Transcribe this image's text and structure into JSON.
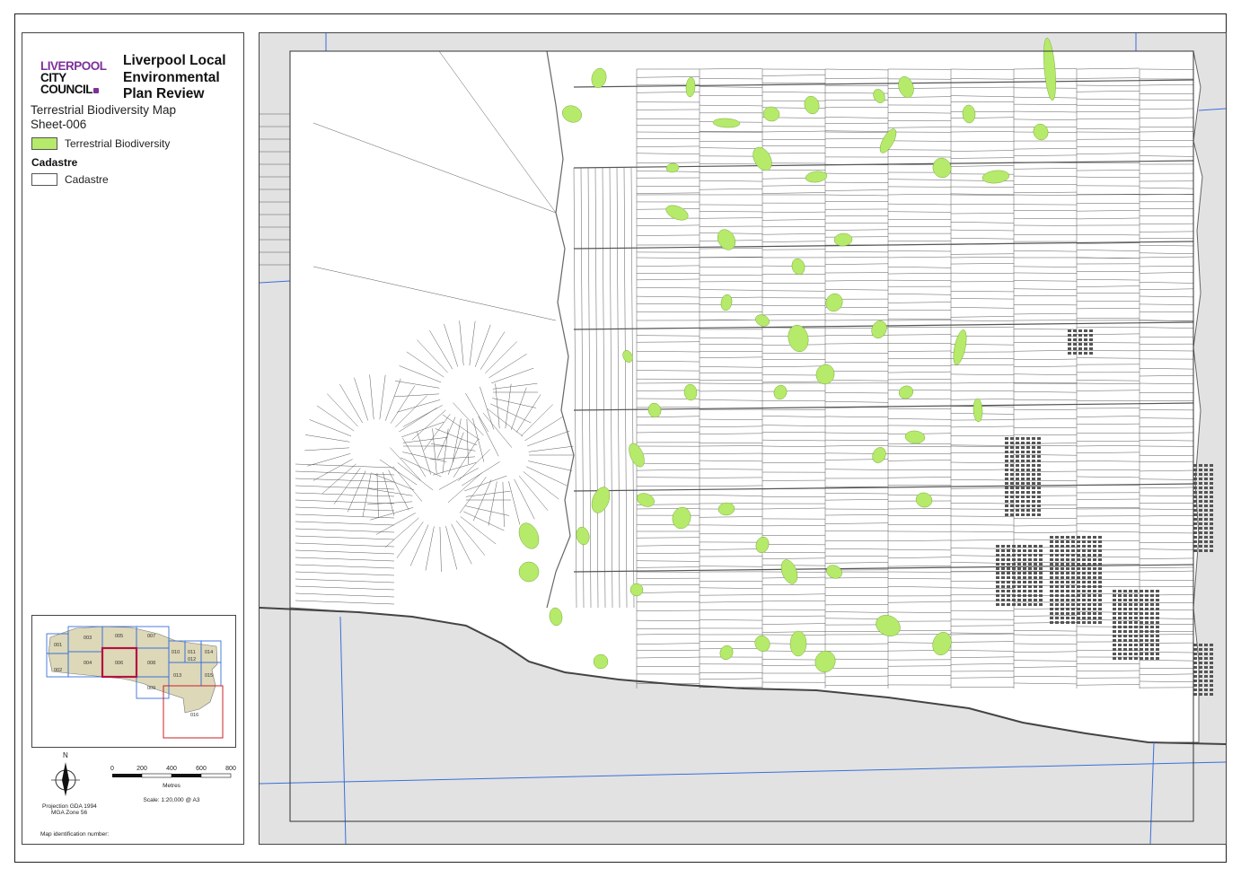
{
  "legend": {
    "logo": {
      "line1": "LIVERPOOL",
      "line2": "CITY",
      "line3": "COUNCIL"
    },
    "plan_title": "Liverpool Local Environmental Plan Review",
    "map_title": "Terrestrial Biodiversity Map",
    "sheet": "Sheet-006",
    "items": [
      {
        "label": "Terrestrial Biodiversity",
        "color": "#b6ea6a"
      }
    ],
    "cadastre_heading": "Cadastre",
    "cadastre_item": "Cadastre",
    "inset_sheets": [
      "001",
      "002",
      "003",
      "004",
      "005",
      "006",
      "007",
      "008",
      "009",
      "010",
      "011",
      "012",
      "013",
      "014",
      "015",
      "016"
    ],
    "current_sheet": "006",
    "north_label": "N",
    "scale_ticks": [
      "0",
      "200",
      "400",
      "600",
      "800"
    ],
    "scale_unit": "Metres",
    "scale_text": "Scale: 1:20,000 @ A3",
    "projection_line1": "Projection GDA 1994",
    "projection_line2": "MGA Zone 56",
    "map_id_label": "Map identification number:"
  },
  "colors": {
    "biodiversity": "#b6ea6a",
    "gridline": "#3b6fd9",
    "outside": "#e2e2e2",
    "current_sheet_border": "#b3123f",
    "study_area_border": "#c8202a"
  }
}
